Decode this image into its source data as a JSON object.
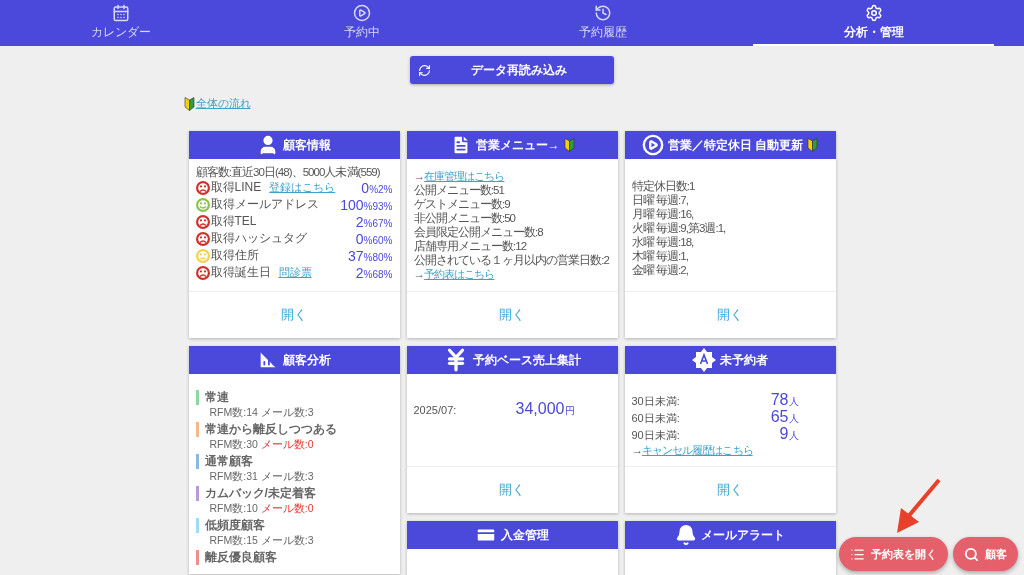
{
  "nav": {
    "tabs": [
      {
        "label": "カレンダー",
        "selected": false
      },
      {
        "label": "予約中",
        "selected": false
      },
      {
        "label": "予約履歴",
        "selected": false
      },
      {
        "label": "分析・管理",
        "selected": true
      }
    ]
  },
  "reload_button": {
    "label": "データ再読み込み"
  },
  "guide_link": {
    "label": "全体の流れ"
  },
  "columns": [
    [
      {
        "kind": "customers",
        "title": "顧客情報",
        "beginner": false,
        "summary": "顧客数:直近30日(48)、5000人未満(559)",
        "rows": [
          {
            "kind": "sad",
            "color": "#d0312d",
            "label": "取得LINE",
            "link": "登録はこちら",
            "value": "0",
            "suffix": "%2%"
          },
          {
            "kind": "smile",
            "color": "#8bc34a",
            "label": "取得メールアドレス",
            "value": "100",
            "suffix": "%93%"
          },
          {
            "kind": "sad",
            "color": "#d0312d",
            "label": "取得TEL",
            "value": "2",
            "suffix": "%67%"
          },
          {
            "kind": "sad",
            "color": "#d0312d",
            "label": "取得ハッシュタグ",
            "value": "0",
            "suffix": "%60%"
          },
          {
            "kind": "flat",
            "color": "#f5d04a",
            "label": "取得住所",
            "value": "37",
            "suffix": "%80%"
          },
          {
            "kind": "sad",
            "color": "#d0312d",
            "label": "取得誕生日",
            "link": "問診票",
            "value": "2",
            "suffix": "%68%"
          }
        ],
        "open_label": "開く"
      },
      {
        "kind": "segments",
        "title": "顧客分析",
        "beginner": false,
        "segments": [
          {
            "name": "常連",
            "color": "#8fd6a0",
            "rfm": "RFM数:14",
            "mail": "メール数:3",
            "alert": false
          },
          {
            "name": "常連から離反しつつある",
            "color": "#f2b98a",
            "rfm": "RFM数:30",
            "mail": "メール数:0",
            "alert": true
          },
          {
            "name": "通常顧客",
            "color": "#8cb8e0",
            "rfm": "RFM数:31",
            "mail": "メール数:3",
            "alert": false
          },
          {
            "name": "カムバック/未定着客",
            "color": "#b89ad6",
            "rfm": "RFM数:10",
            "mail": "メール数:0",
            "alert": true
          },
          {
            "name": "低頻度顧客",
            "color": "#9fdcf2",
            "rfm": "RFM数:15",
            "mail": "メール数:3",
            "alert": false
          },
          {
            "name": "離反優良顧客",
            "color": "#ee8f8f"
          }
        ]
      }
    ],
    [
      {
        "kind": "menu",
        "title": "営業メニュー→",
        "beginner": true,
        "lines": [
          {
            "prefix": "→",
            "link": "在庫管理はこちら"
          },
          {
            "text": "公開メニュー数:51"
          },
          {
            "text": "ゲストメニュー数:9"
          },
          {
            "text": "非公開メニュー数:50"
          },
          {
            "text": "会員限定公開メニュー数:8"
          },
          {
            "text": "店舗専用メニュー数:12"
          },
          {
            "text": "公開されている１ヶ月以内の営業日数:2"
          },
          {
            "prefix": "→",
            "link": "予約表はこちら"
          }
        ],
        "open_label": "開く"
      },
      {
        "kind": "sales",
        "title": "予約ベース売上集計",
        "beginner": false,
        "period": "2025/07:",
        "amount": "34,000",
        "unit": "円",
        "open_label": "開く"
      },
      {
        "kind": "payments",
        "title": "入金管理",
        "beginner": false
      }
    ],
    [
      {
        "kind": "holidays",
        "title": "営業／特定休日 自動更新",
        "beginner": true,
        "lines": [
          {
            "text": "特定休日数:1"
          },
          {
            "text": "日曜 毎週:7,"
          },
          {
            "text": "月曜 毎週:16,"
          },
          {
            "text": "火曜 毎週:9,第3週:1,"
          },
          {
            "text": "水曜 毎週:18,"
          },
          {
            "text": "木曜 毎週:1,"
          },
          {
            "text": "金曜 毎週:2,"
          }
        ],
        "open_label": "開く"
      },
      {
        "kind": "unbooked",
        "title": "未予約者",
        "beginner": false,
        "counts": [
          {
            "label": "30日未満:",
            "value": "78",
            "unit": "人"
          },
          {
            "label": "60日未満:",
            "value": "65",
            "unit": "人"
          },
          {
            "label": "90日未満:",
            "value": "9",
            "unit": "人"
          }
        ],
        "link_prefix": "→",
        "link": "キャンセル履歴はこちら",
        "open_label": "開く"
      },
      {
        "kind": "alerts",
        "title": "メールアラート",
        "beginner": false
      }
    ]
  ],
  "fab_buttons": [
    {
      "label": "予約表を開く"
    },
    {
      "label": "顧客"
    }
  ]
}
